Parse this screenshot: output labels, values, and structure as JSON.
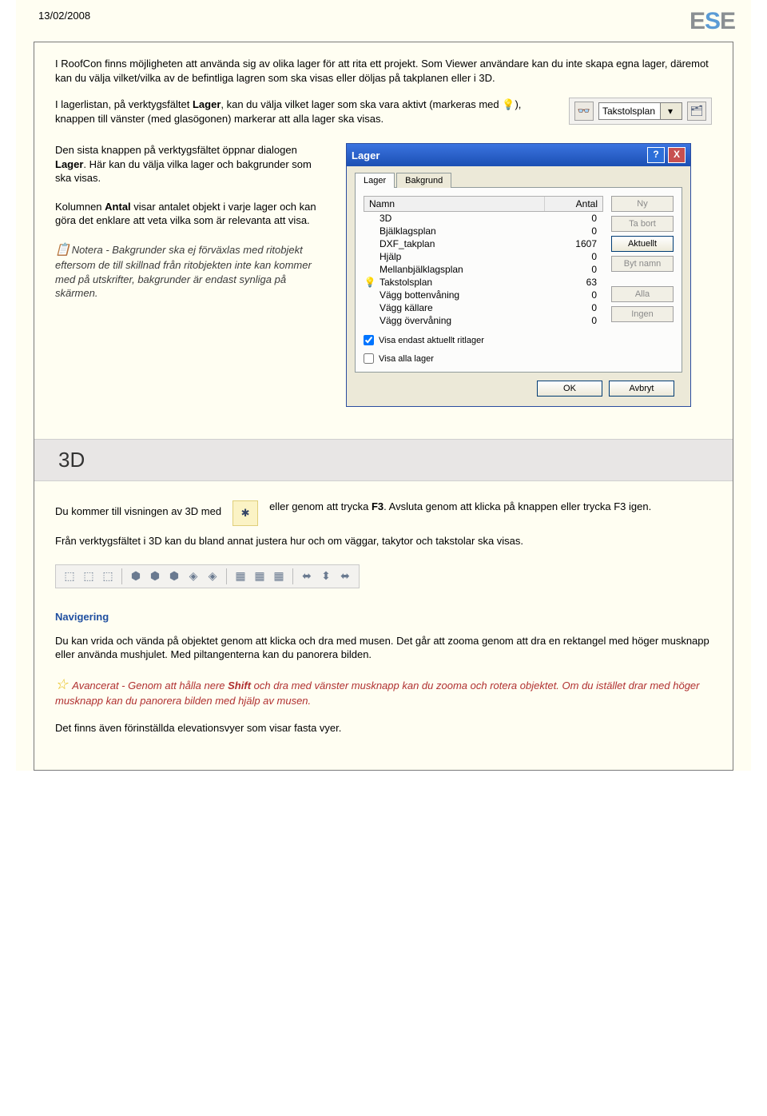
{
  "header": {
    "date": "13/02/2008",
    "logo": {
      "a": "E",
      "b": "S",
      "c": "E"
    }
  },
  "intro": "I RoofCon finns möjligheten att använda sig av olika lager för att rita ett projekt. Som Viewer användare kan du inte skapa egna lager, däremot kan du välja vilket/vilka av de befintliga lagren som ska visas eller döljas på takplanen eller i 3D.",
  "para2": {
    "pre": "I lagerlistan, på verktygsfältet ",
    "b": "Lager",
    "post": ", kan du välja vilket lager som ska vara aktivt (markeras med ",
    "after": "), knappen till vänster (med glasögonen) markerar att alla lager ska visas."
  },
  "toolbar": {
    "selected": "Takstolsplan"
  },
  "para3": {
    "a": "Den sista knappen på verktygsfältet öppnar dialogen ",
    "b": "Lager",
    "c": ". Här kan du välja vilka lager och bakgrunder som ska visas."
  },
  "para4": {
    "a": "Kolumnen ",
    "b": "Antal",
    "c": " visar antalet objekt i varje lager och kan göra det enklare att veta vilka som är relevanta att visa."
  },
  "note": "Notera - Bakgrunder ska ej förväxlas med ritobjekt eftersom de till skillnad från ritobjekten inte kan kommer med på utskrifter, bakgrunder är endast synliga på skärmen.",
  "dialog": {
    "title": "Lager",
    "help": "?",
    "close": "X",
    "tabs": {
      "t1": "Lager",
      "t2": "Bakgrund"
    },
    "cols": {
      "name": "Namn",
      "count": "Antal"
    },
    "rows": [
      {
        "n": "3D",
        "c": "0"
      },
      {
        "n": "Bjälklagsplan",
        "c": "0"
      },
      {
        "n": "DXF_takplan",
        "c": "1607"
      },
      {
        "n": "Hjälp",
        "c": "0"
      },
      {
        "n": "Mellanbjälklagsplan",
        "c": "0"
      },
      {
        "n": "Takstolsplan",
        "c": "63",
        "active": true
      },
      {
        "n": "Vägg bottenvåning",
        "c": "0"
      },
      {
        "n": "Vägg källare",
        "c": "0"
      },
      {
        "n": "Vägg övervåning",
        "c": "0"
      }
    ],
    "btns": {
      "ny": "Ny",
      "tabort": "Ta bort",
      "aktuellt": "Aktuellt",
      "bytnamn": "Byt namn",
      "alla": "Alla",
      "ingen": "Ingen"
    },
    "chk1": "Visa endast aktuellt ritlager",
    "chk2": "Visa alla lager",
    "ok": "OK",
    "cancel": "Avbryt"
  },
  "section3d": "3D",
  "s3d": {
    "a": "Du kommer till visningen av 3D med",
    "b1": "eller genom att trycka ",
    "b2": "F3",
    "b3": ". Avsluta genom att klicka på knappen eller trycka F3 igen.",
    "c": "Från verktygsfältet i 3D kan du bland annat justera hur och om väggar, takytor och takstolar ska visas."
  },
  "nav": {
    "h": "Navigering",
    "p1": "Du kan vrida och vända på objektet genom att klicka och dra med musen. Det går att zooma genom att dra en rektangel med höger musknapp eller använda mushjulet. Med piltangenterna kan du panorera bilden.",
    "adv": {
      "a": " Avancerat - Genom att hålla nere ",
      "b": "Shift",
      "c": " och dra med vänster musknapp kan du zooma och rotera objektet. Om du istället drar med höger musknapp kan du panorera bilden med hjälp av musen."
    },
    "p2": "Det finns även förinställda elevationsvyer som visar fasta vyer."
  }
}
